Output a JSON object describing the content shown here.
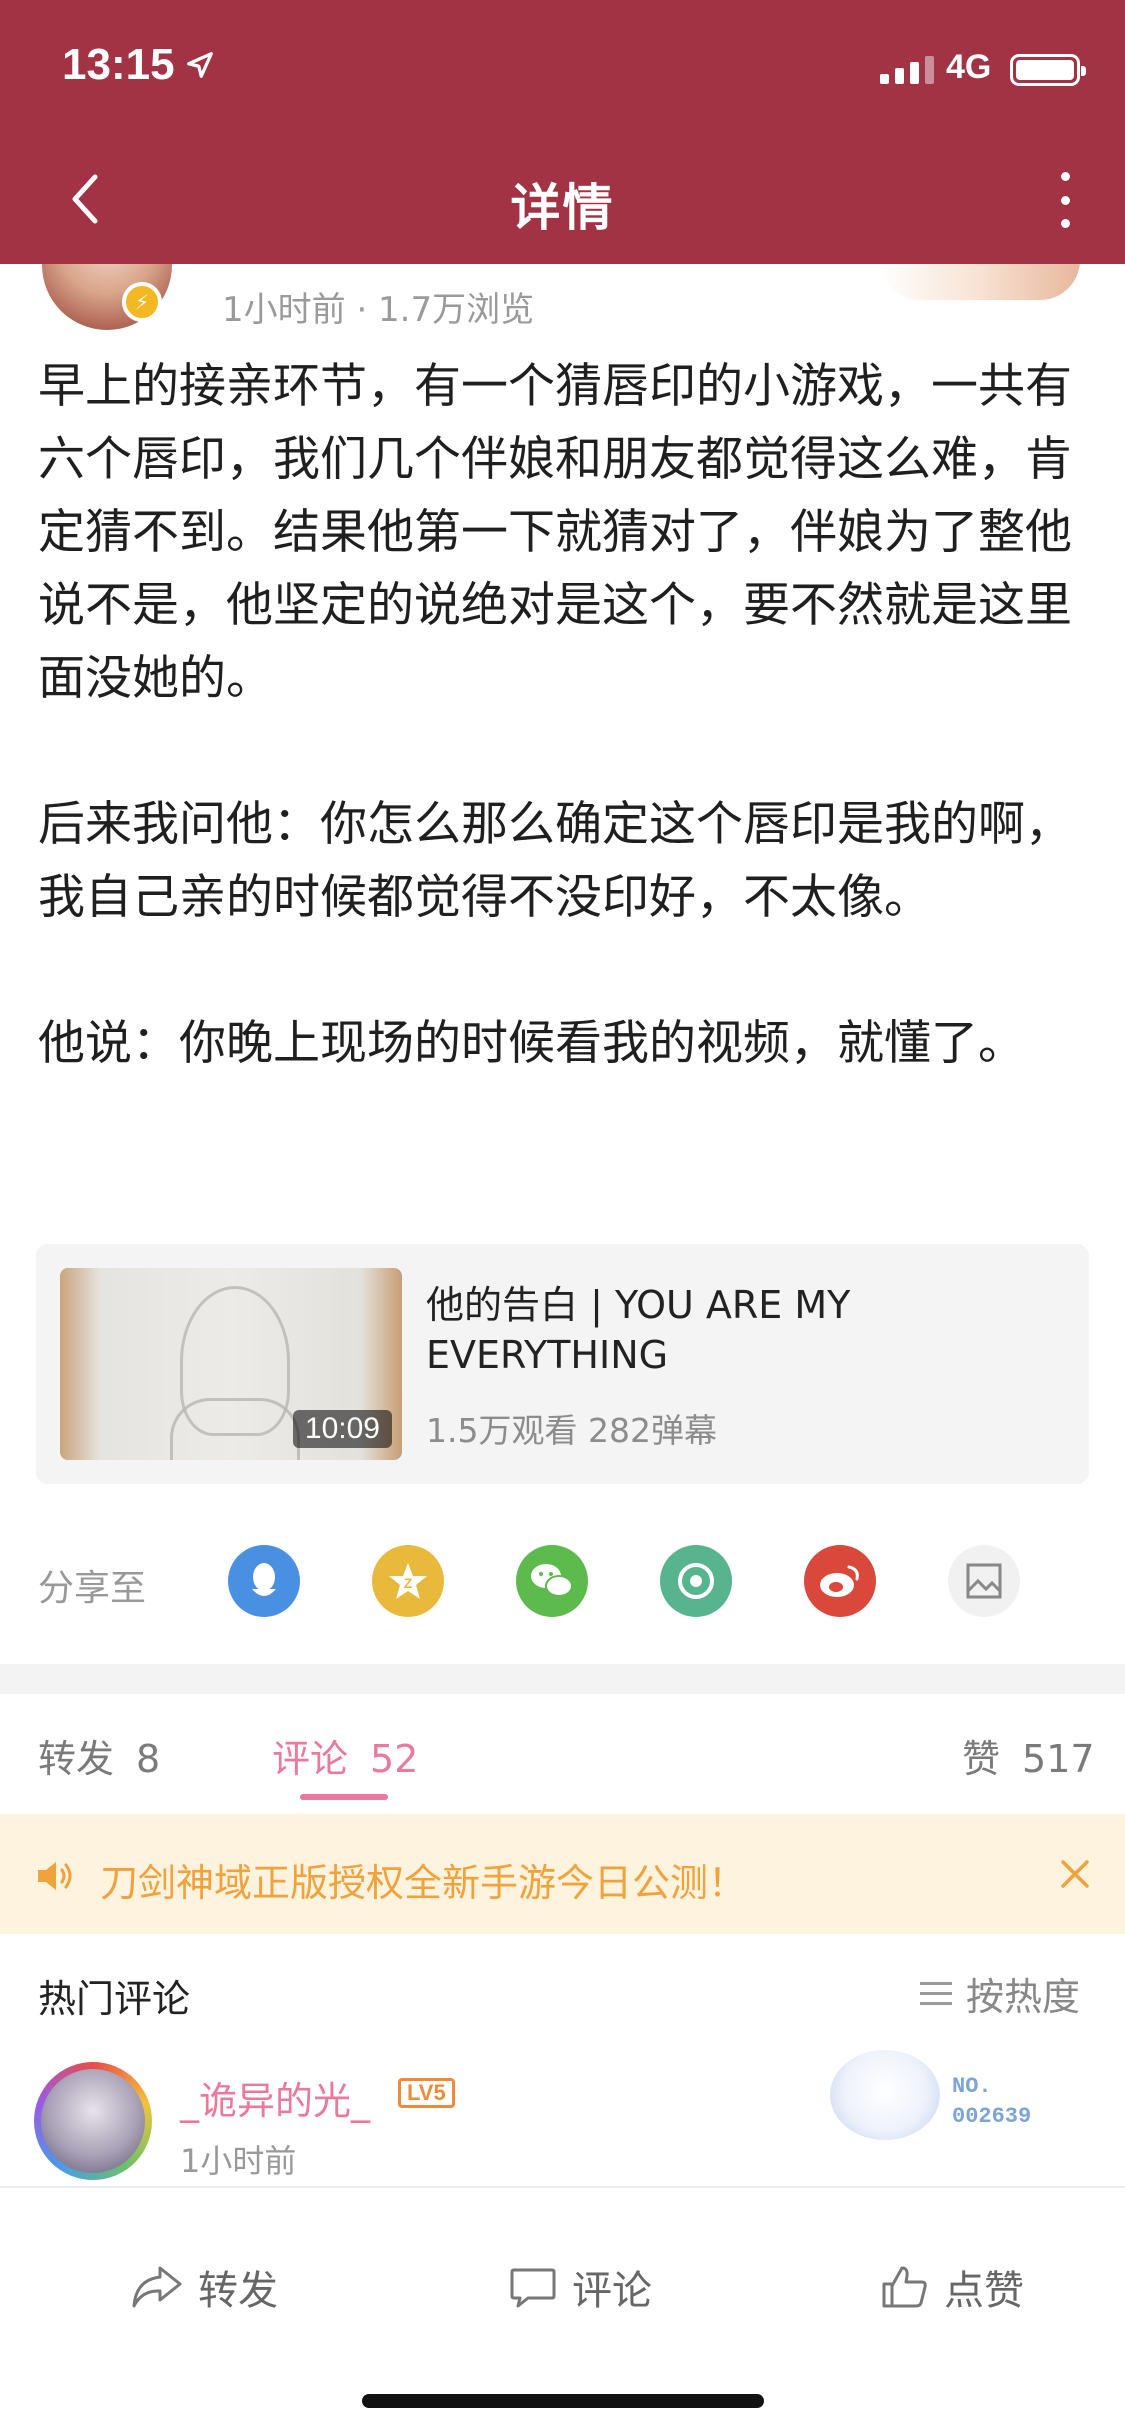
{
  "status_bar": {
    "time": "13:15",
    "network": "4G"
  },
  "nav": {
    "title": "详情"
  },
  "author": {
    "meta": "1小时前 · 1.7万浏览"
  },
  "post": {
    "paragraphs": [
      "早上的接亲环节，有一个猜唇印的小游戏，一共有六个唇印，我们几个伴娘和朋友都觉得这么难，肯定猜不到。结果他第一下就猜对了，伴娘为了整他说不是，他坚定的说绝对是这个，要不然就是这里面没她的。",
      "后来我问他：你怎么那么确定这个唇印是我的啊，我自己亲的时候都觉得不没印好，不太像。",
      "他说：你晚上现场的时候看我的视频，就懂了。"
    ]
  },
  "video": {
    "title": "他的告白 | YOU ARE MY EVERYTHING",
    "duration": "10:09",
    "stats": "1.5万观看 282弹幕"
  },
  "share": {
    "label": "分享至",
    "targets": [
      {
        "icon": "qq-icon",
        "color": "#4a90e2"
      },
      {
        "icon": "qzone-icon",
        "color": "#e9b93c"
      },
      {
        "icon": "wechat-icon",
        "color": "#5dbb4e"
      },
      {
        "icon": "moments-icon",
        "color": "#57b48f"
      },
      {
        "icon": "weibo-icon",
        "color": "#d9483b"
      },
      {
        "icon": "image-share-icon",
        "color": "#f1f1f1"
      }
    ]
  },
  "tabs": [
    {
      "label": "转发",
      "count": "8"
    },
    {
      "label": "评论",
      "count": "52"
    },
    {
      "label": "赞",
      "count": "517"
    }
  ],
  "notice": {
    "text": "刀剑神域正版授权全新手游今日公测！"
  },
  "comments": {
    "header": "热门评论",
    "sort_label": "按热度",
    "items": [
      {
        "name": "_诡异的光_",
        "level": "LV5",
        "time": "1小时前",
        "fan_label": "NO.",
        "fan_number": "002639"
      }
    ]
  },
  "bottom_bar": {
    "repost": "转发",
    "comment": "评论",
    "like": "点赞"
  },
  "colors": {
    "header_bg": "#a23345",
    "accent_pink": "#e97a9c",
    "notice_bg": "#fdf3de",
    "notice_text": "#f0a23b"
  }
}
